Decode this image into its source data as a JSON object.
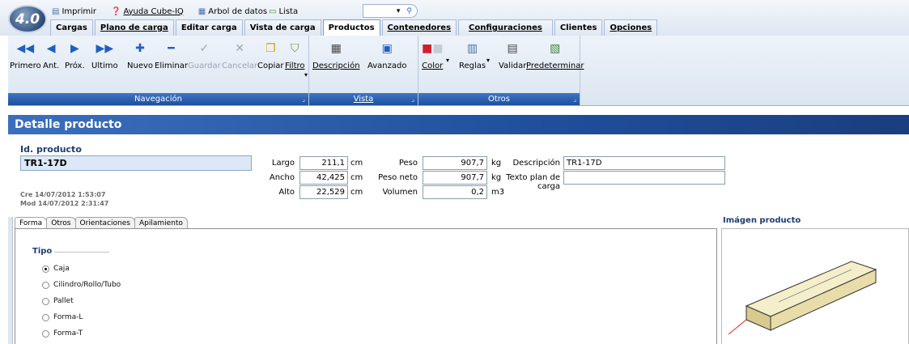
{
  "app": {
    "version_logo": "4.0"
  },
  "quick_access": {
    "items": [
      {
        "label": "Imprimir",
        "icon": "printer-icon"
      },
      {
        "label": "Ayuda Cube-IQ",
        "icon": "help-icon"
      },
      {
        "label": "Arbol de datos",
        "icon": "tree-icon"
      },
      {
        "label": "Lista",
        "icon": "list-icon"
      }
    ]
  },
  "tabs": [
    {
      "label": "Cargas"
    },
    {
      "label": "Plano de carga"
    },
    {
      "label": "Editar carga"
    },
    {
      "label": "Vista de carga"
    },
    {
      "label": "Productos",
      "active": true
    },
    {
      "label": "Contenedores"
    },
    {
      "label": "Configuraciones"
    },
    {
      "label": "Clientes"
    },
    {
      "label": "Opciones"
    }
  ],
  "ribbon": {
    "nav": {
      "label": "Navegación",
      "buttons": [
        "Primero",
        "Ant.",
        "Próx.",
        "Ultimo",
        "Nuevo",
        "Eliminar",
        "Guardar",
        "Cancelar",
        "Copiar",
        "Filtro"
      ]
    },
    "vista": {
      "label": "Vista",
      "buttons": [
        "Descripción",
        "Avanzado"
      ]
    },
    "otros": {
      "label": "Otros",
      "buttons": [
        "Color",
        "Reglas",
        "Validar",
        "Predeterminar"
      ]
    }
  },
  "detail": {
    "title": "Detalle producto",
    "id_label": "Id. producto",
    "id_value": "TR1-17D",
    "created": "Cre 14/07/2012 1:53:07",
    "modified": "Mod 14/07/2012 2:31:47",
    "largo": {
      "label": "Largo",
      "value": "211,1",
      "unit": "cm"
    },
    "ancho": {
      "label": "Ancho",
      "value": "42,425",
      "unit": "cm"
    },
    "alto": {
      "label": "Alto",
      "value": "22,529",
      "unit": "cm"
    },
    "peso": {
      "label": "Peso",
      "value": "907,7",
      "unit": "kg"
    },
    "peso_neto": {
      "label": "Peso neto",
      "value": "907,7",
      "unit": "kg"
    },
    "volumen": {
      "label": "Volumen",
      "value": "0,2",
      "unit": "m3"
    },
    "descripcion": {
      "label": "Descripción",
      "value": "TR1-17D"
    },
    "texto_plan": {
      "label": "Texto plan de carga",
      "value": ""
    }
  },
  "product_tabs": [
    "Forma",
    "Otros",
    "Orientaciones",
    "Apilamiento"
  ],
  "forma": {
    "group_label": "Tipo",
    "options": [
      {
        "label": "Caja",
        "selected": true
      },
      {
        "label": "Cilindro/Rollo/Tubo",
        "selected": false
      },
      {
        "label": "Pallet",
        "selected": false
      },
      {
        "label": "Forma-L",
        "selected": false
      },
      {
        "label": "Forma-T",
        "selected": false
      }
    ]
  },
  "image_panel": {
    "label": "Imágen producto"
  },
  "colors": {
    "accent": "#1f4f9b",
    "box": "#f3e9c0"
  }
}
